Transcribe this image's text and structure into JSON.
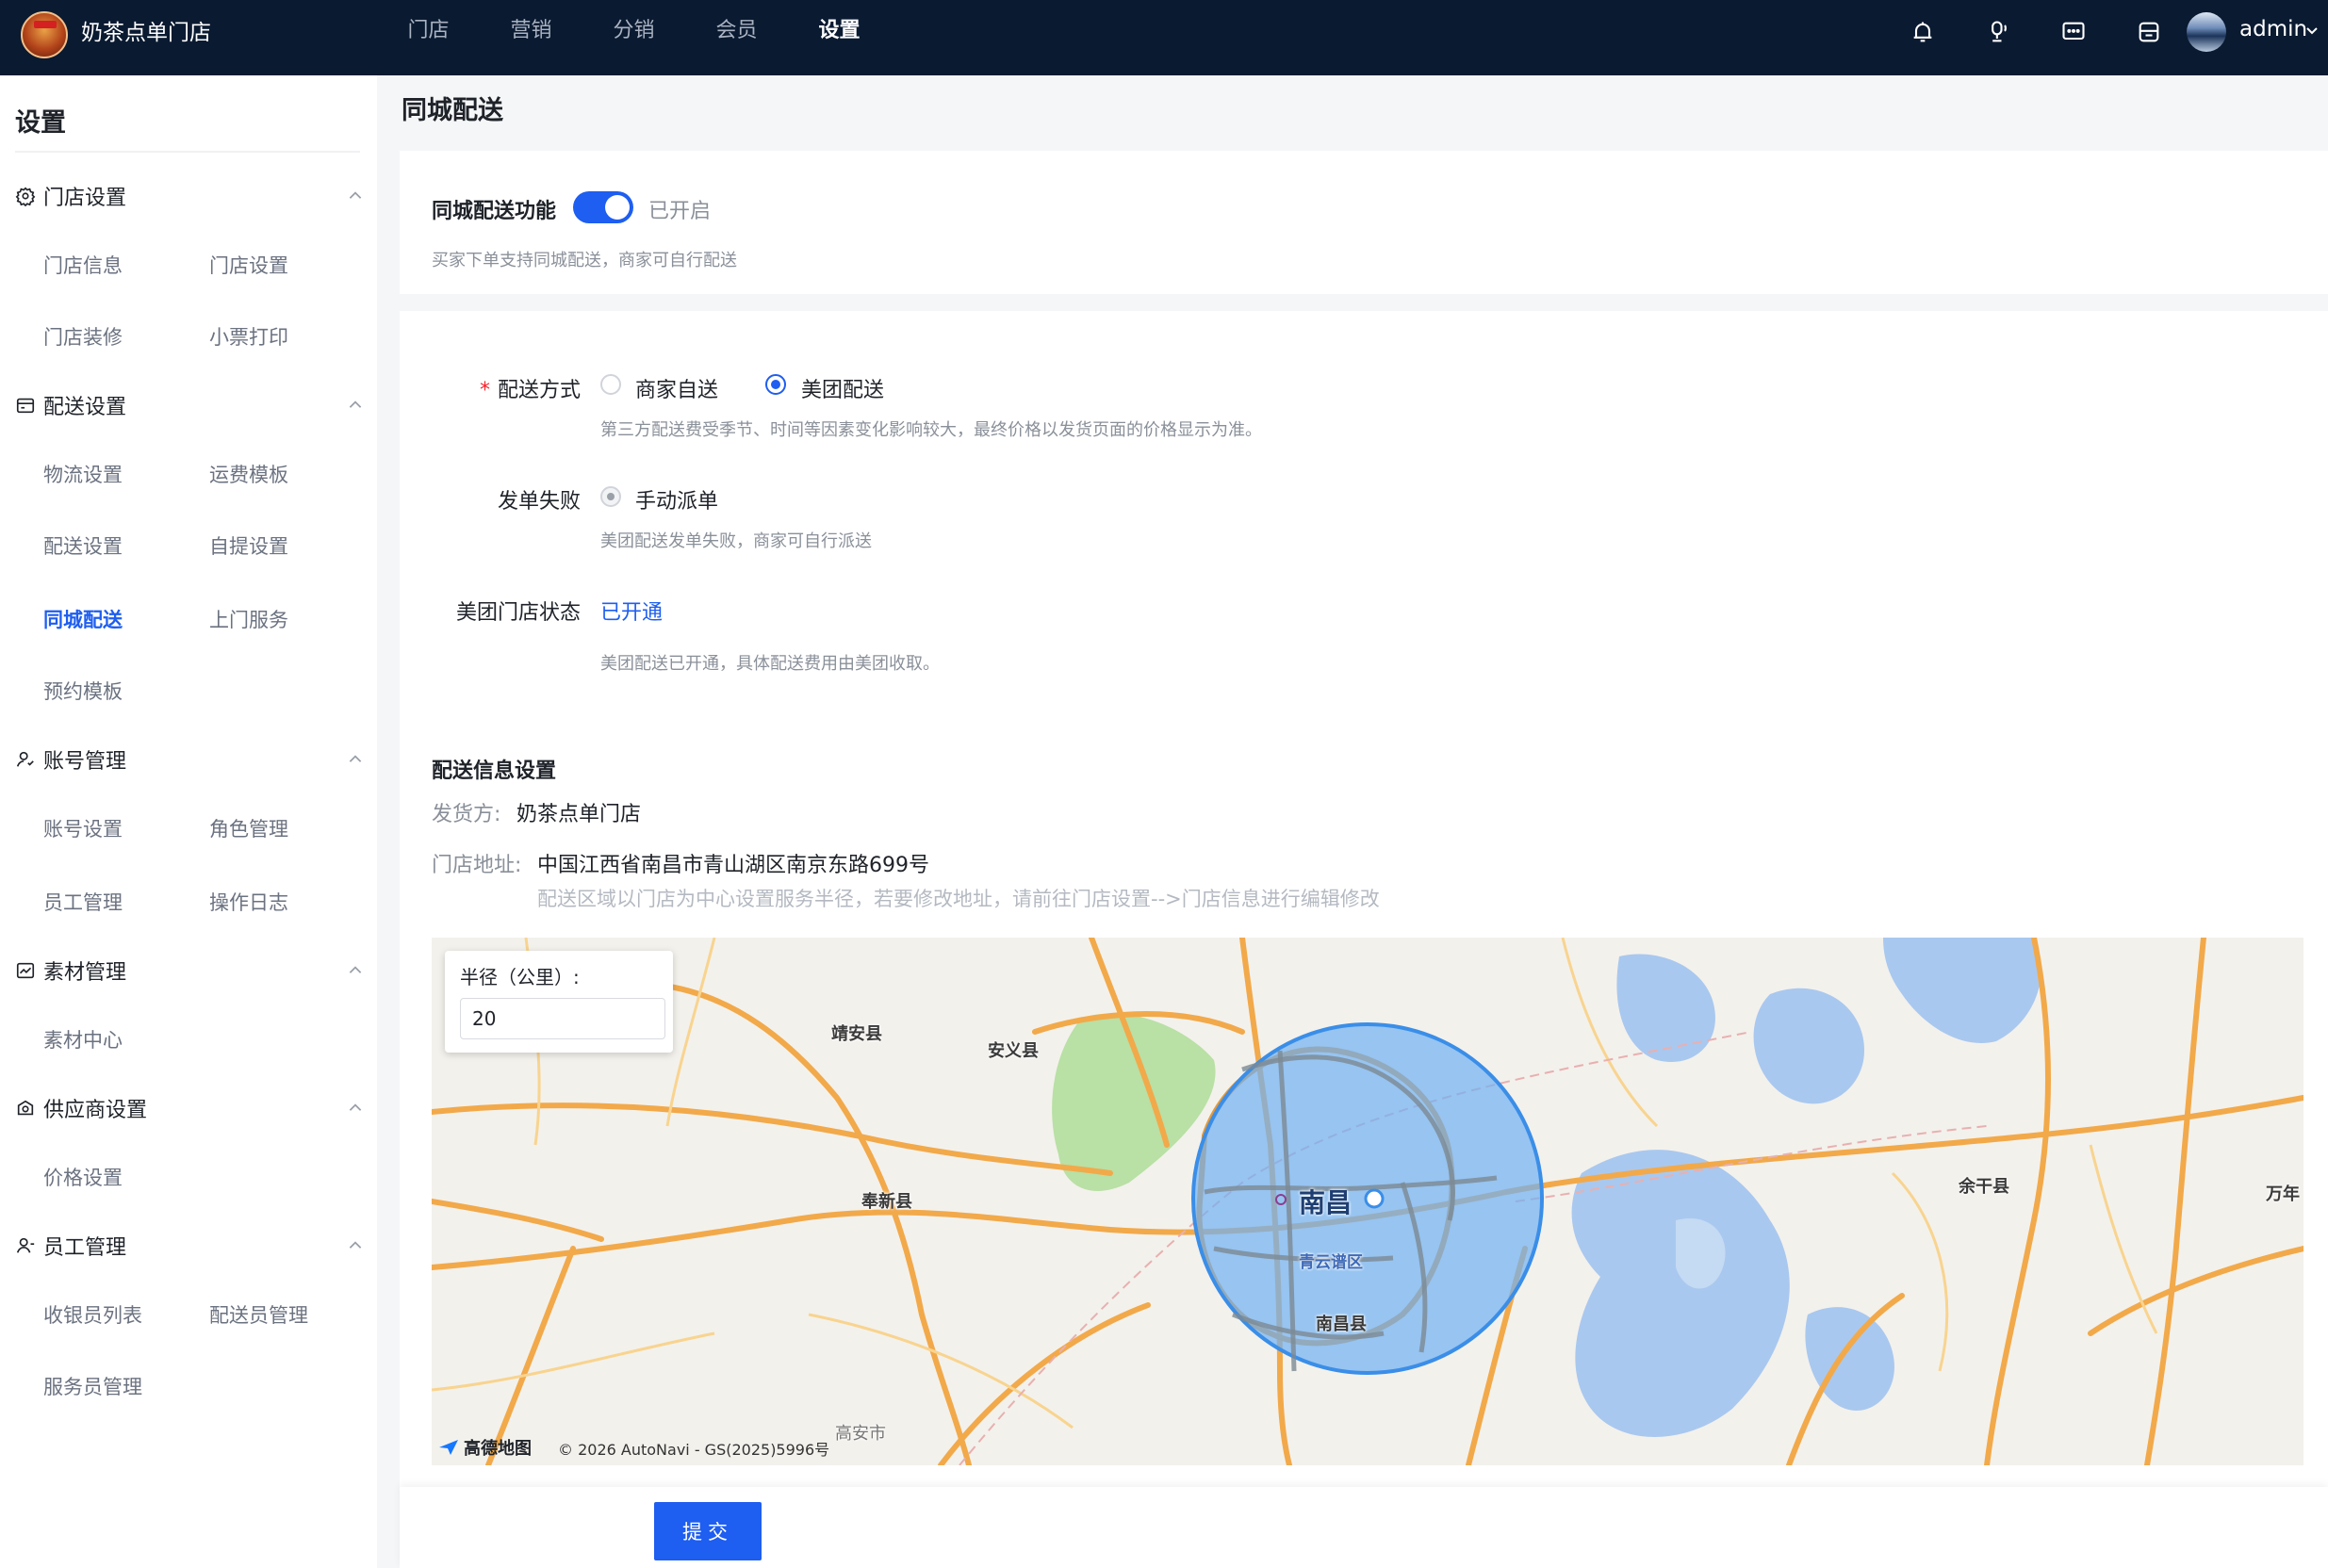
{
  "header": {
    "brand": "奶茶点单门店",
    "nav": [
      {
        "label": "门店",
        "active": false
      },
      {
        "label": "营销",
        "active": false
      },
      {
        "label": "分销",
        "active": false
      },
      {
        "label": "会员",
        "active": false
      },
      {
        "label": "设置",
        "active": true
      }
    ],
    "icons": [
      "bell-icon",
      "headset-icon",
      "message-icon",
      "store-icon"
    ],
    "user": "admin"
  },
  "sidebar": {
    "title": "设置",
    "groups": [
      {
        "label": "门店设置",
        "icon": "gear-icon",
        "items": [
          "门店信息",
          "门店设置",
          "门店装修",
          "小票打印"
        ]
      },
      {
        "label": "配送设置",
        "icon": "wallet-icon",
        "items": [
          "物流设置",
          "运费模板",
          "配送设置",
          "自提设置",
          "同城配送",
          "上门服务",
          "预约模板"
        ]
      },
      {
        "label": "账号管理",
        "icon": "user-icon",
        "items": [
          "账号设置",
          "角色管理",
          "员工管理",
          "操作日志"
        ]
      },
      {
        "label": "素材管理",
        "icon": "chart-icon",
        "items": [
          "素材中心"
        ]
      },
      {
        "label": "供应商设置",
        "icon": "supplier-icon",
        "items": [
          "价格设置"
        ]
      },
      {
        "label": "员工管理",
        "icon": "staff-icon",
        "items": [
          "收银员列表",
          "配送员管理",
          "服务员管理"
        ]
      }
    ],
    "active_item": "同城配送"
  },
  "page": {
    "title": "同城配送",
    "feature": {
      "label": "同城配送功能",
      "enabled": true,
      "status": "已开启",
      "hint": "买家下单支持同城配送，商家可自行配送"
    },
    "delivery_method": {
      "required_mark": "*",
      "label": "配送方式",
      "options": [
        {
          "label": "商家自送",
          "checked": false
        },
        {
          "label": "美团配送",
          "checked": true
        }
      ],
      "hint": "第三方配送费受季节、时间等因素变化影响较大，最终价格以发货页面的价格显示为准。"
    },
    "order_failure": {
      "label": "发单失败",
      "option": "手动派单",
      "hint": "美团配送发单失败，商家可自行派送"
    },
    "meituan_status": {
      "label": "美团门店状态",
      "value": "已开通",
      "hint": "美团配送已开通，具体配送费用由美团收取。"
    },
    "delivery_info": {
      "title": "配送信息设置",
      "shipper_label": "发货方:",
      "shipper_value": "奶茶点单门店",
      "address_label": "门店地址:",
      "address_value": "中国江西省南昌市青山湖区南京东路699号",
      "address_hint": "配送区域以门店为中心设置服务半径，若要修改地址，请前往门店设置-->门店信息进行编辑修改"
    },
    "map": {
      "radius_label": "半径（公里）:",
      "radius_value": "20",
      "labels": {
        "city": "南昌",
        "district": "青云谱区",
        "county1": "南昌县",
        "jingan": "靖安县",
        "anyi": "安义县",
        "fengxin": "奉新县",
        "yugan": "余干县",
        "wannian": "万年",
        "gaoan": "高安市"
      },
      "logo": "高德地图",
      "copyright": "© 2026 AutoNavi - GS(2025)5996号",
      "colors": {
        "radius_fill": "#6fb0f3",
        "radius_stroke": "#3a8ee8",
        "road": "#f2a94a",
        "water": "#a9c8ef",
        "park": "#b9e0a5"
      }
    },
    "submit_label": "提交"
  }
}
